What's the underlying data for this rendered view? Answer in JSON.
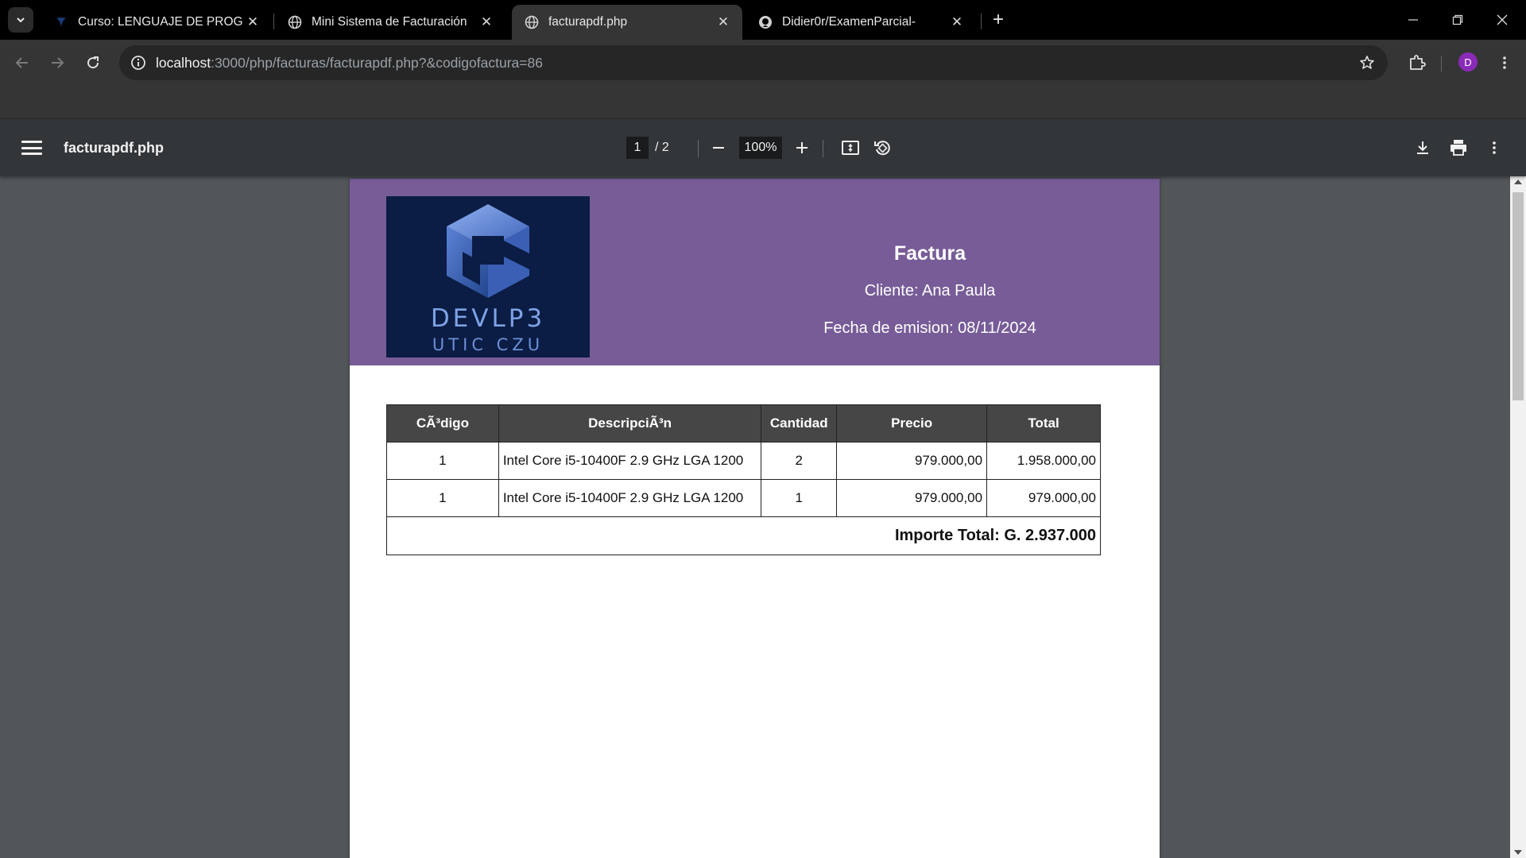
{
  "tabs": [
    {
      "title": "Curso: LENGUAJE DE PROGRAMACIÓN",
      "favicon": "course-icon",
      "active": false
    },
    {
      "title": "Mini Sistema de Facturación",
      "favicon": "globe-icon",
      "active": false
    },
    {
      "title": "facturapdf.php",
      "favicon": "globe-icon",
      "active": true
    },
    {
      "title": "Didier0r/ExamenParcial-",
      "favicon": "github-icon",
      "active": false
    }
  ],
  "address_bar": {
    "host": "localhost",
    "path": ":3000/php/facturas/facturapdf.php?&codigofactura=86"
  },
  "profile_initial": "D",
  "pdf_viewer": {
    "title": "facturapdf.php",
    "current_page": "1",
    "page_total": "/  2",
    "zoom": "100%"
  },
  "invoice": {
    "logo_text": "DEVLP3",
    "logo_subtext": "UTIC CZU",
    "title": "Factura",
    "client": "Cliente: Ana Paula",
    "date": "Fecha de emision: 08/11/2024",
    "headers": [
      "CÃ³digo",
      "DescripciÃ³n",
      "Cantidad",
      "Precio",
      "Total"
    ],
    "rows": [
      {
        "codigo": "1",
        "descripcion": "Intel Core i5-10400F 2.9 GHz LGA 1200",
        "cantidad": "2",
        "precio": "979.000,00",
        "total": "1.958.000,00"
      },
      {
        "codigo": "1",
        "descripcion": "Intel Core i5-10400F 2.9 GHz LGA 1200",
        "cantidad": "1",
        "precio": "979.000,00",
        "total": "979.000,00"
      }
    ],
    "importe_total": "Importe Total: G. 2.937.000"
  },
  "colors": {
    "header_purple": "#775c98",
    "table_header": "#464646",
    "viewer_bg": "#525659"
  }
}
